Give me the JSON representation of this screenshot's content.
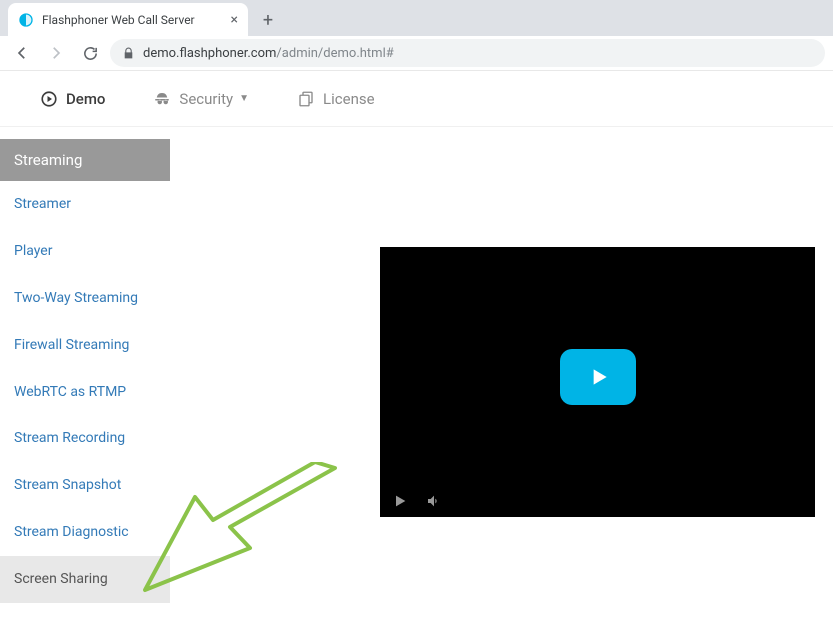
{
  "browser": {
    "tab_title": "Flashphoner Web Call Server",
    "url_prefix": "demo.flashphoner.com",
    "url_suffix": "/admin/demo.html#"
  },
  "top_nav": {
    "demo": "Demo",
    "security": "Security",
    "license": "License"
  },
  "sidebar": {
    "header": "Streaming",
    "items": [
      "Streamer",
      "Player",
      "Two-Way Streaming",
      "Firewall Streaming",
      "WebRTC as RTMP",
      "Stream Recording",
      "Stream Snapshot",
      "Stream Diagnostic",
      "Screen Sharing"
    ]
  }
}
